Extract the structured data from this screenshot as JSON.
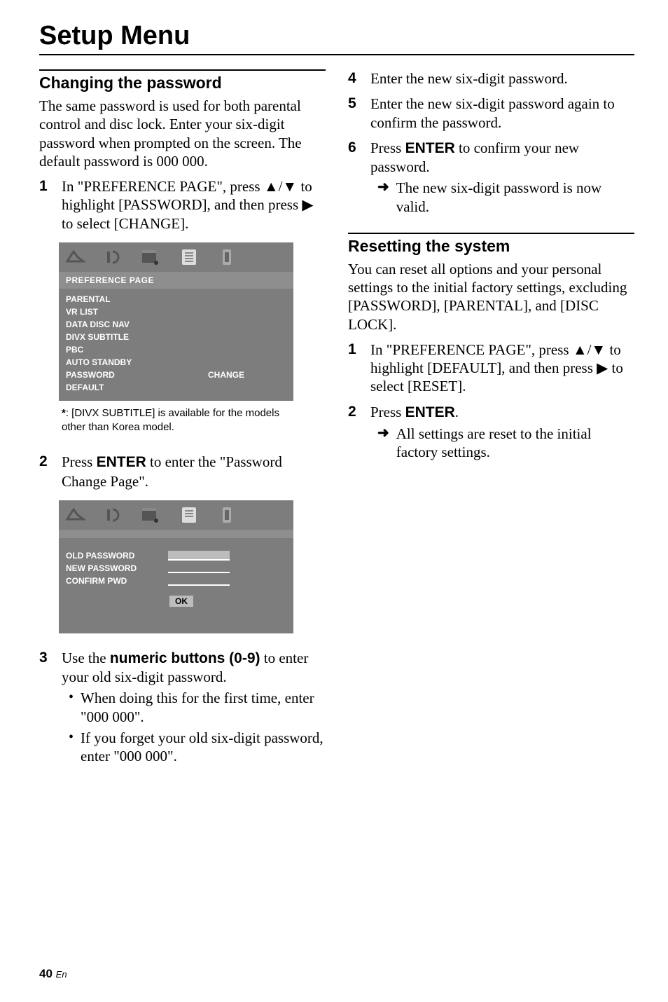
{
  "chapter_title": "Setup Menu",
  "left": {
    "section_heading": "Changing the password",
    "intro": "The same password is used for both parental control and disc lock. Enter your six-digit password when prompted on the screen. The default password is 000 000.",
    "step1_a": "In \"PREFERENCE PAGE\", press ",
    "step1_arrows": "▲/▼",
    "step1_b": " to highlight [PASSWORD], and then press ",
    "step1_play": "▶",
    "step1_c": " to select [CHANGE].",
    "osd1": {
      "title": "PREFERENCE PAGE",
      "items": [
        "PARENTAL",
        "VR LIST",
        "DATA DISC NAV",
        "DIVX SUBTITLE",
        "PBC",
        "AUTO STANDBY",
        "PASSWORD",
        "DEFAULT"
      ],
      "change_label": "CHANGE"
    },
    "footnote": ": [DIVX SUBTITLE] is available for the models other than Korea model.",
    "step2_a": "Press ",
    "step2_enter": "ENTER",
    "step2_b": " to enter the \"Password Change Page\".",
    "osd2": {
      "rows": [
        "OLD PASSWORD",
        "NEW PASSWORD",
        "CONFIRM PWD"
      ],
      "ok": "OK"
    },
    "step3_a": "Use the ",
    "step3_buttons": "numeric buttons (0-9)",
    "step3_b": " to enter your old six-digit password.",
    "step3_bullets": [
      "When doing this for the first time, enter \"000 000\".",
      "If you forget your old six-digit password, enter \"000 000\"."
    ]
  },
  "right": {
    "step4": "Enter the new six-digit password.",
    "step5": "Enter the new six-digit password again to confirm the password.",
    "step6_a": "Press ",
    "step6_enter": "ENTER",
    "step6_b": " to confirm your new password.",
    "step6_arrow": "The new six-digit password is now valid.",
    "section_heading": "Resetting the system",
    "intro": "You can reset all options and your personal settings to the initial factory settings, excluding [PASSWORD], [PARENTAL], and [DISC LOCK].",
    "r_step1_a": "In \"PREFERENCE PAGE\", press ",
    "r_step1_arrows": "▲/▼",
    "r_step1_b": " to highlight [DEFAULT], and then press ",
    "r_step1_play": "▶",
    "r_step1_c": " to select [RESET].",
    "r_step2_a": "Press ",
    "r_step2_enter": "ENTER",
    "r_step2_b": ".",
    "r_step2_arrow": "All settings are reset to the initial factory settings."
  },
  "page": {
    "num": "40",
    "lang": "En"
  }
}
